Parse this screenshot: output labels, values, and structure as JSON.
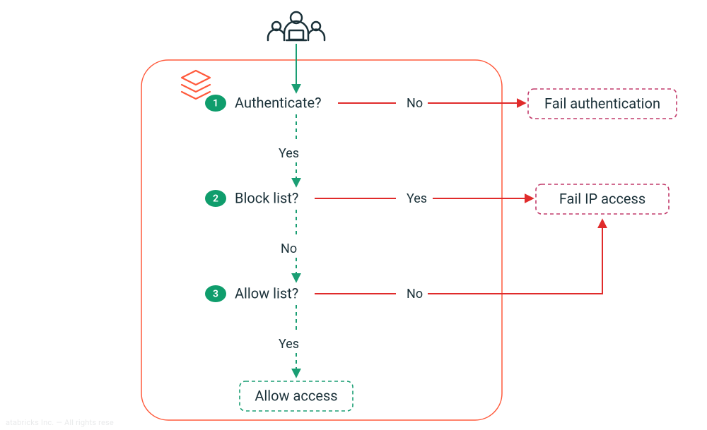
{
  "diagram": {
    "steps": [
      {
        "num": "1",
        "label": "Authenticate?"
      },
      {
        "num": "2",
        "label": "Block list?"
      },
      {
        "num": "3",
        "label": "Allow list?"
      }
    ],
    "edges": {
      "auth_no": "No",
      "auth_yes": "Yes",
      "block_yes": "Yes",
      "block_no": "No",
      "allow_no": "No",
      "allow_yes": "Yes"
    },
    "outcomes": {
      "fail_auth": "Fail authentication",
      "fail_ip": "Fail IP access",
      "allow_access": "Allow access"
    }
  },
  "footer": "atabricks Inc. — All rights rese"
}
